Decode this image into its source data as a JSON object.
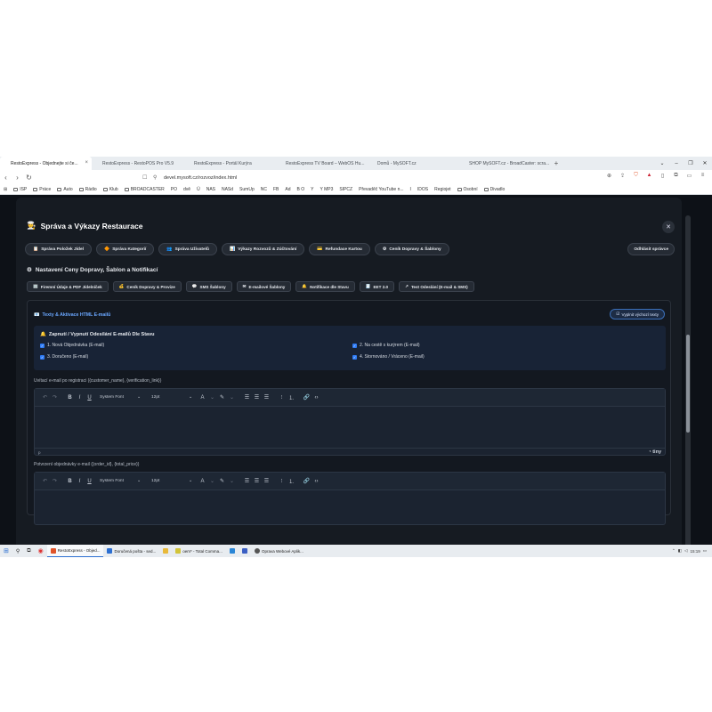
{
  "browser": {
    "tabs": [
      "RestoExpress - Objednejte si če...",
      "RestoExpress - RestoPOS Pro V5.9",
      "RestoExpress - Portál Kurýra",
      "RestoExpress TV Board – WebOS Hu...",
      "Domů - MySOFT.cz",
      "SHOP MySOFT.cz - BroadCaster: scra..."
    ],
    "url": "devel.mysoft.cz/rozvoz/index.html",
    "bookmarks": [
      "ISP",
      "Práce",
      "Auto",
      "Rádio",
      "Klub",
      "BROADCASTER",
      "PO",
      "dvě",
      "Ú",
      "NAS",
      "NASd",
      "SumUp",
      "NC",
      "FB",
      "Ad",
      "B O",
      "Y",
      "Y MP3",
      "SIPCZ",
      "Převaděč YouTube n...",
      "I",
      "IDOS",
      "Regiojet",
      "Osobní",
      "Divadlo"
    ]
  },
  "app": {
    "title": "Správa a Výkazy Restaurace",
    "title_icon": "🧑‍🍳",
    "close_label": "✕",
    "main_nav": [
      {
        "icon": "📋",
        "label": "Správa Položek Jídel"
      },
      {
        "icon": "🔶",
        "label": "Správa Kategorií"
      },
      {
        "icon": "👥",
        "label": "Správa Uživatelů"
      },
      {
        "icon": "📊",
        "label": "Výkazy Rozvozů & Zúčtování"
      },
      {
        "icon": "💳",
        "label": "Refundace Kartou"
      },
      {
        "icon": "⚙",
        "label": "Ceník Dopravy & Šablony"
      }
    ],
    "logout_label": "Odhlásit správce",
    "section": {
      "icon": "⚙",
      "title": "Nastavení Ceny Dopravy, Šablon a Notifikací"
    },
    "sub_nav": [
      {
        "icon": "🏢",
        "label": "Firemní Údaje & PDF Jídelníček"
      },
      {
        "icon": "💰",
        "label": "Ceník Dopravy & Provize"
      },
      {
        "icon": "💬",
        "label": "SMS Šablony"
      },
      {
        "icon": "✉",
        "label": "E-mailové Šablony"
      },
      {
        "icon": "🔔",
        "label": "Notifikace dle Stavu"
      },
      {
        "icon": "🧾",
        "label": "EET 2.0"
      },
      {
        "icon": "↗",
        "label": "Test Odeslání (E-mail & SMS)"
      }
    ],
    "panel": {
      "icon": "📧",
      "title": "Texty & Aktivace HTML E-mailů",
      "fill_button": "Vyplnit výchozí texty",
      "status_title": "Zapnutí / Vypnutí Odesílání E-mailů Dle Stavu",
      "status_icon": "🔔",
      "checkboxes": [
        {
          "label": "1. Nová Objednávka (E-mail)",
          "checked": true
        },
        {
          "label": "2. Na cestě s kurýrem (E-mail)",
          "checked": true
        },
        {
          "label": "3. Doručeno (E-mail)",
          "checked": true
        },
        {
          "label": "4. Stornováno / Vráceno (E-mail)",
          "checked": true
        }
      ],
      "editor1_label": "Uvítací e-mail po registraci ({customer_name}, {verification_link})",
      "editor2_label": "Potvrzení objednávky e-mail ({order_id}, {total_price})",
      "editor_font": "System Font",
      "editor_size": "12pt",
      "editor_status_path": "p",
      "tiny_brand": "tiny"
    }
  },
  "taskbar": {
    "items": [
      "RestoExpress - Objed...",
      "Doručená pošta - sed...",
      "",
      "oem* - Total Comma...",
      "",
      "Oprava Webové Aplik..."
    ],
    "time": "15:19"
  },
  "colors": {
    "app_bg": "#161b22",
    "accent_blue": "#2f7cf6",
    "panel_heading": "#6aa7ff"
  }
}
